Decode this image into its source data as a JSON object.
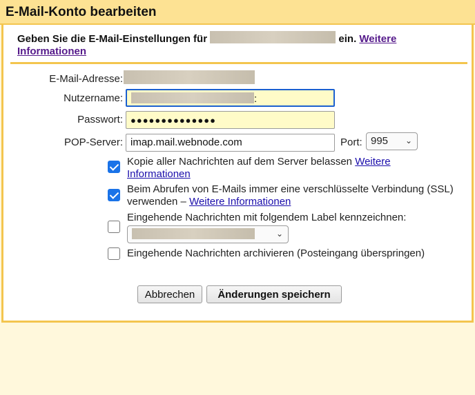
{
  "dialog": {
    "title": "E-Mail-Konto bearbeiten",
    "intro_prefix": "Geben Sie die E-Mail-Einstellungen für",
    "intro_suffix": "ein.",
    "intro_link": "Weitere Informationen"
  },
  "form": {
    "email_label": "E-Mail-Adresse:",
    "username_label": "Nutzername:",
    "username_trailing": ":",
    "password_label": "Passwort:",
    "password_value": "●●●●●●●●●●●●●●",
    "pop_label": "POP-Server:",
    "pop_value": "imap.mail.webnode.com",
    "port_label": "Port:",
    "port_value": "995"
  },
  "options": {
    "keep_copy": {
      "checked": true,
      "text": "Kopie aller Nachrichten auf dem Server belassen",
      "link": "Weitere Informationen"
    },
    "ssl": {
      "checked": true,
      "text": "Beim Abrufen von E-Mails immer eine verschlüsselte Verbindung (SSL) verwenden –",
      "link": "Weitere Informationen"
    },
    "label_incoming": {
      "checked": false,
      "text": "Eingehende Nachrichten mit folgendem Label kennzeichnen:"
    },
    "archive": {
      "checked": false,
      "text": "Eingehende Nachrichten archivieren (Posteingang überspringen)"
    }
  },
  "buttons": {
    "cancel": "Abbrechen",
    "save": "Änderungen speichern"
  },
  "colors": {
    "title_bar": "#fde293",
    "border": "#f3c54e",
    "checkbox": "#1a73e8",
    "link": "#551a8b"
  }
}
